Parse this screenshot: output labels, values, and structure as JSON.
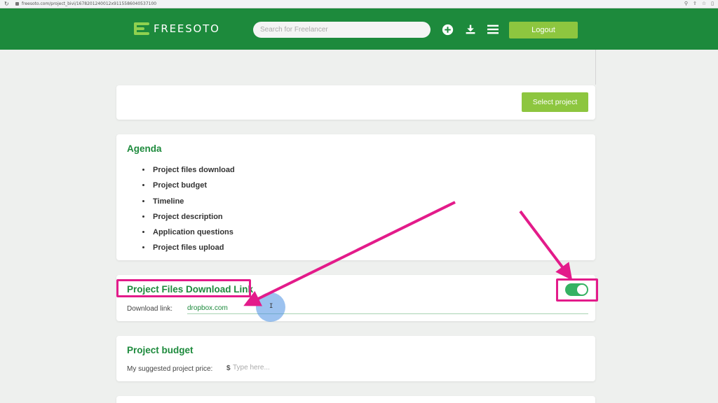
{
  "browser": {
    "url": "freesoto.com/project_bivi/1678201240012x9115586040537100"
  },
  "header": {
    "logo_text": "FREESOTO",
    "search_placeholder": "Search for Freelancer",
    "logout_label": "Logout"
  },
  "select_card": {
    "button_label": "Select project"
  },
  "agenda": {
    "title": "Agenda",
    "items": [
      "Project files download",
      "Project budget",
      "Timeline",
      "Project description",
      "Application questions",
      "Project files upload"
    ]
  },
  "download_card": {
    "title": "Project Files Download Link",
    "field_label": "Download link:",
    "field_value": "dropbox.com",
    "toggle_on": true
  },
  "budget_card": {
    "title": "Project budget",
    "field_label": "My suggested project price:",
    "currency": "$",
    "price_placeholder": "Type here..."
  },
  "colors": {
    "brand_green": "#1d8a3c",
    "accent_green": "#8dc63f",
    "toggle_green": "#34b262",
    "annotation_pink": "#e31b8a"
  }
}
